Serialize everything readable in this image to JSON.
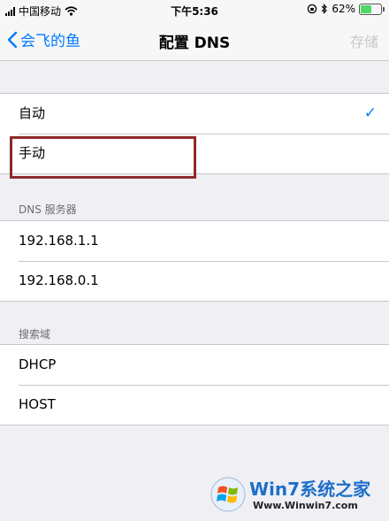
{
  "status_bar": {
    "carrier": "中国移动",
    "time": "下午5:36",
    "battery_percent": "62%",
    "battery_level": 0.62,
    "icons": [
      "signal-icon",
      "wifi-icon",
      "rotation-lock-icon",
      "bluetooth-icon",
      "battery-icon"
    ]
  },
  "nav": {
    "back_label": "会飞的鱼",
    "title": "配置 DNS",
    "save_label": "存储"
  },
  "mode_group": {
    "items": [
      {
        "label": "自动",
        "checked": true
      },
      {
        "label": "手动",
        "checked": false
      }
    ]
  },
  "dns_section": {
    "header": "DNS 服务器",
    "servers": [
      "192.168.1.1",
      "192.168.0.1"
    ]
  },
  "search_section": {
    "header": "搜索域",
    "domains": [
      "DHCP",
      "HOST"
    ]
  },
  "watermark": {
    "name": "Win7系统之家",
    "url": "Www.Winwin7.com"
  },
  "colors": {
    "accent": "#007aff",
    "highlight_box": "#8e2a2a",
    "battery": "#4cd964"
  }
}
